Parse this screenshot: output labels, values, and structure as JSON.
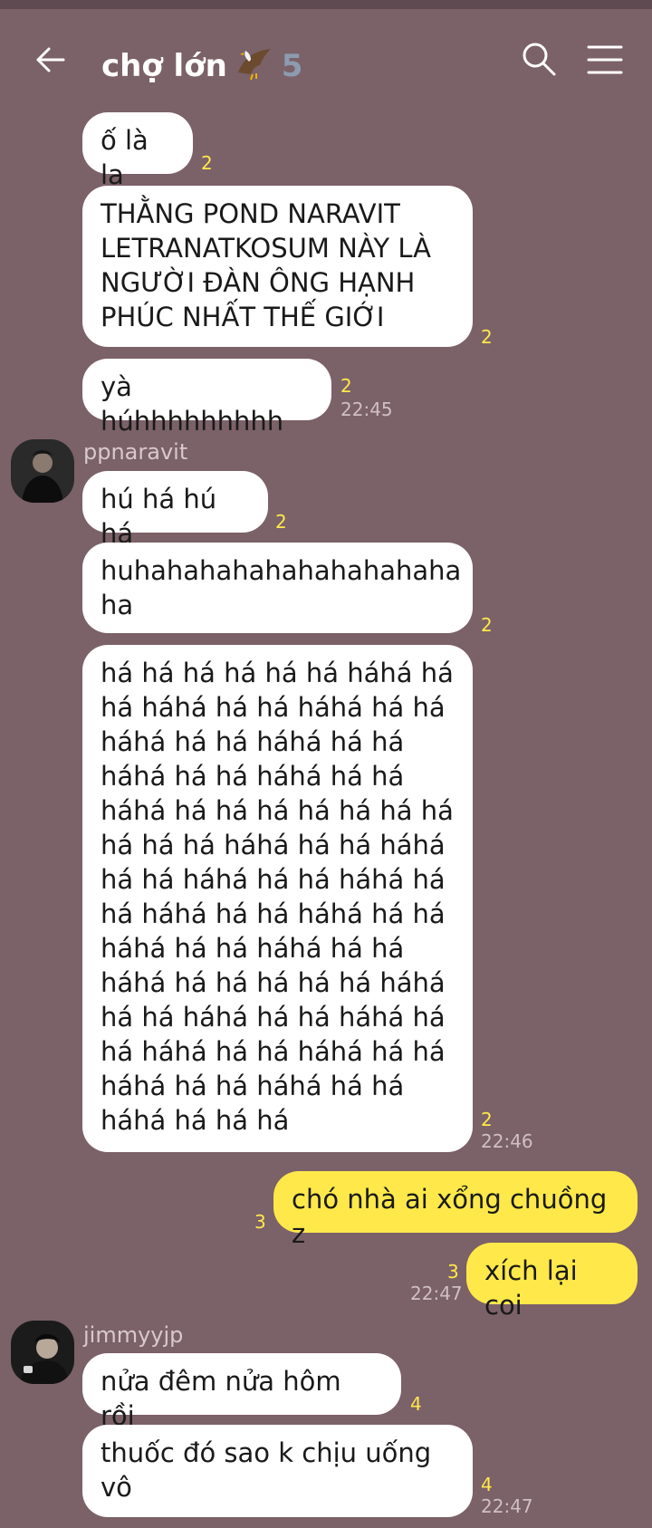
{
  "header": {
    "title": "chợ lớn",
    "member_count": "5",
    "icons": [
      "back-arrow-icon",
      "eagle-emoji",
      "search-icon",
      "menu-icon"
    ]
  },
  "messages": [
    {
      "id": "m1",
      "text": "ố là la",
      "read": "2"
    },
    {
      "id": "m2",
      "text": "THẰNG POND NARAVIT LETRANATKOSUM NÀY LÀ NGƯỜI ĐÀN ÔNG HẠNH PHÚC NHẤT THẾ GIỚI",
      "read": "2"
    },
    {
      "id": "m3",
      "text": "yà húhhhhhhhhh",
      "read": "2",
      "time": "22:45"
    },
    {
      "id": "m4",
      "sender": "ppnaravit",
      "text": "hú há hú há",
      "read": "2"
    },
    {
      "id": "m5",
      "text": "huhahahahahahahahahaha ha",
      "read": "2"
    },
    {
      "id": "m6",
      "text": "há há há há há há háhá há há háhá há há háhá há há háhá há há háhá há há háhá há há háhá há há háhá há há há há há há há há há há háhá há há háhá há há háhá há há háhá há há háhá há há háhá há há háhá há há háhá há há háhá há há há há há háhá há há háhá há há háhá há há háhá há há háhá há há háhá há há háhá há há háhá há há há",
      "read": "2",
      "time": "22:46"
    },
    {
      "id": "m7",
      "mine": true,
      "text": "chó nhà ai xổng chuồng z",
      "read": "3"
    },
    {
      "id": "m8",
      "mine": true,
      "text": "xích lại coi",
      "read": "3",
      "time": "22:47"
    },
    {
      "id": "m9",
      "sender": "jimmyyjp",
      "text": "nửa đêm nửa hôm rồi",
      "read": "4"
    },
    {
      "id": "m10",
      "text": "thuốc đó sao k chịu uống vô",
      "read": "4",
      "time": "22:47"
    }
  ],
  "colors": {
    "background": "#7b6168",
    "bubble": "#ffffff",
    "my_bubble": "#ffe94a",
    "read_count": "#ffe94a"
  }
}
